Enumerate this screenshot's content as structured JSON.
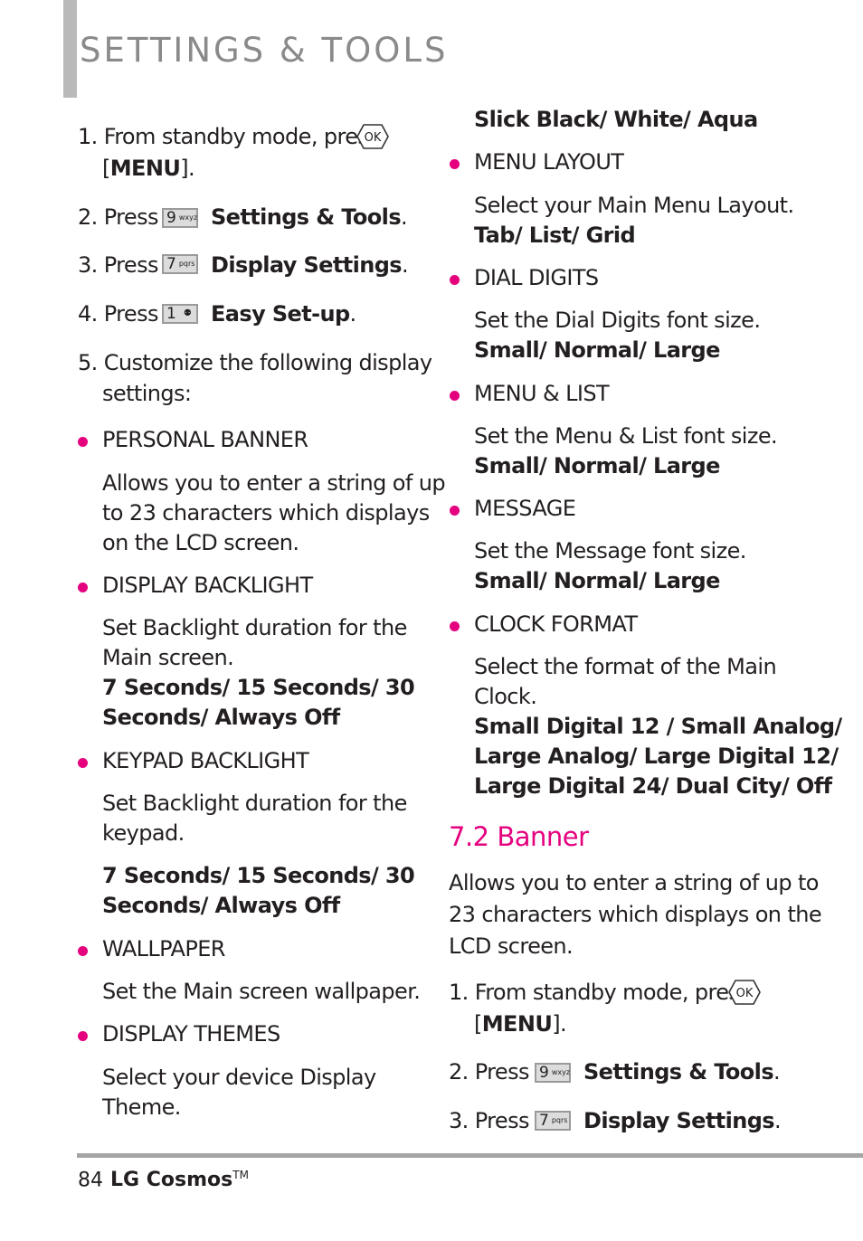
{
  "header": {
    "title": "SETTINGS & TOOLS"
  },
  "left_column": {
    "steps": [
      {
        "num": "1.",
        "text": "From standby mode, press",
        "key": "OK",
        "cont": "[MENU].",
        "cont_bold": "MENU"
      },
      {
        "num": "2.",
        "text": "Press",
        "key": {
          "digit": "9",
          "letters": "wxyz"
        },
        "action": "Settings & Tools"
      },
      {
        "num": "3.",
        "text": "Press",
        "key": {
          "digit": "7",
          "letters": "pqrs"
        },
        "action": "Display Settings"
      },
      {
        "num": "4.",
        "text": "Press",
        "key": {
          "digit": "1",
          "letters": ""
        },
        "action": "Easy Set-up"
      },
      {
        "num": "5.",
        "line1": "Customize the following display",
        "line2": "settings:"
      }
    ],
    "items": [
      {
        "title": "PERSONAL BANNER",
        "desc": [
          "Allows you to enter a string of up",
          "to 23 characters which displays",
          "on the  LCD screen."
        ]
      },
      {
        "title": "DISPLAY BACKLIGHT",
        "desc": [
          "Set Backlight duration for the",
          "Main screen."
        ],
        "options": [
          "7 Seconds/ 15 Seconds/ 30",
          "Seconds/ Always Off"
        ]
      },
      {
        "title": "KEYPAD BACKLIGHT",
        "desc": [
          "Set Backlight duration for the",
          "keypad."
        ],
        "options": [
          "7 Seconds/ 15 Seconds/ 30",
          "Seconds/ Always Off"
        ]
      },
      {
        "title": "WALLPAPER",
        "desc": [
          "Set the Main screen wallpaper."
        ]
      },
      {
        "title": "DISPLAY THEMES",
        "desc": [
          "Select your device Display",
          "Theme."
        ]
      }
    ]
  },
  "right_column": {
    "theme_options": "Slick Black/ White/ Aqua",
    "items": [
      {
        "title": "MENU LAYOUT",
        "desc": [
          "Select your Main Menu Layout."
        ],
        "options": [
          "Tab/ List/ Grid"
        ]
      },
      {
        "title": "DIAL DIGITS",
        "desc": [
          "Set the Dial Digits font size."
        ],
        "options": [
          "Small/ Normal/ Large"
        ]
      },
      {
        "title": "MENU & LIST",
        "desc": [
          "Set the Menu & List font size."
        ],
        "options": [
          "Small/ Normal/ Large"
        ]
      },
      {
        "title": "MESSAGE",
        "desc": [
          "Set the Message font size."
        ],
        "options": [
          "Small/ Normal/ Large"
        ]
      },
      {
        "title": "CLOCK FORMAT",
        "desc": [
          "Select the format of the Main",
          "Clock."
        ],
        "options": [
          "Small Digital 12 / Small Analog/",
          "Large Analog/ Large Digital 12/",
          "Large Digital 24/ Dual City/ Off"
        ]
      }
    ],
    "section": {
      "title": "7.2 Banner",
      "intro": [
        "Allows you to enter a string of up to",
        "23 characters which displays on the",
        "LCD screen."
      ],
      "steps": [
        {
          "num": "1.",
          "text": "From standby mode, press",
          "key": "OK",
          "cont": "[MENU]."
        },
        {
          "num": "2.",
          "text": "Press",
          "key": {
            "digit": "9",
            "letters": "wxyz"
          },
          "action": "Settings & Tools"
        },
        {
          "num": "3.",
          "text": "Press",
          "key": {
            "digit": "7",
            "letters": "pqrs"
          },
          "action": "Display Settings"
        }
      ]
    }
  },
  "footer": {
    "page_number": "84",
    "brand": "LG Cosmos",
    "trademark": "TM"
  },
  "colors": {
    "accent": "#e5007e",
    "header_bar": "#b9b9b9",
    "title_gray": "#8a8a8a",
    "rule_gray": "#a5a5a5",
    "text": "#231f20"
  }
}
